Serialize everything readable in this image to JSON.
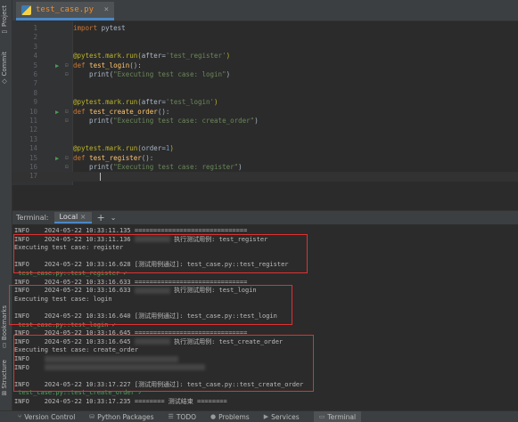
{
  "left_strip": {
    "project_label": "Project",
    "commit_label": "Commit",
    "bookmarks_label": "Bookmarks",
    "structure_label": "Structure"
  },
  "editor": {
    "tab_name": "test_case.py",
    "tab_close": "×",
    "lines": [
      {
        "n": "1",
        "parts": [
          {
            "t": "import ",
            "c": "kw"
          },
          {
            "t": "pytest",
            "c": "plain"
          }
        ]
      },
      {
        "n": "2",
        "parts": []
      },
      {
        "n": "3",
        "parts": []
      },
      {
        "n": "4",
        "parts": [
          {
            "t": "@pytest.mark.run(",
            "c": "dec"
          },
          {
            "t": "after=",
            "c": "plain"
          },
          {
            "t": "'test_register'",
            "c": "str"
          },
          {
            "t": ")",
            "c": "dec"
          }
        ]
      },
      {
        "n": "5",
        "run": true,
        "fold": true,
        "parts": [
          {
            "t": "def ",
            "c": "kw"
          },
          {
            "t": "test_login",
            "c": "fn"
          },
          {
            "t": "():",
            "c": "plain"
          }
        ]
      },
      {
        "n": "6",
        "fold": true,
        "parts": [
          {
            "t": "    print(",
            "c": "plain"
          },
          {
            "t": "\"Executing test case: login\"",
            "c": "str"
          },
          {
            "t": ")",
            "c": "plain"
          }
        ]
      },
      {
        "n": "7",
        "parts": []
      },
      {
        "n": "8",
        "parts": []
      },
      {
        "n": "9",
        "parts": [
          {
            "t": "@pytest.mark.run(",
            "c": "dec"
          },
          {
            "t": "after=",
            "c": "plain"
          },
          {
            "t": "'test_login'",
            "c": "str"
          },
          {
            "t": ")",
            "c": "dec"
          }
        ]
      },
      {
        "n": "10",
        "run": true,
        "fold": true,
        "parts": [
          {
            "t": "def ",
            "c": "kw"
          },
          {
            "t": "test_create_order",
            "c": "fn"
          },
          {
            "t": "():",
            "c": "plain"
          }
        ]
      },
      {
        "n": "11",
        "fold": true,
        "parts": [
          {
            "t": "    print(",
            "c": "plain"
          },
          {
            "t": "\"Executing test case: create_order\"",
            "c": "str"
          },
          {
            "t": ")",
            "c": "plain"
          }
        ]
      },
      {
        "n": "12",
        "parts": []
      },
      {
        "n": "13",
        "parts": []
      },
      {
        "n": "14",
        "parts": [
          {
            "t": "@pytest.mark.run(",
            "c": "dec"
          },
          {
            "t": "order=",
            "c": "plain"
          },
          {
            "t": "1",
            "c": "num"
          },
          {
            "t": ")",
            "c": "dec"
          }
        ]
      },
      {
        "n": "15",
        "run": true,
        "fold": true,
        "parts": [
          {
            "t": "def ",
            "c": "kw"
          },
          {
            "t": "test_register",
            "c": "fn"
          },
          {
            "t": "():",
            "c": "plain"
          }
        ]
      },
      {
        "n": "16",
        "fold": true,
        "parts": [
          {
            "t": "    print(",
            "c": "plain"
          },
          {
            "t": "\"Executing test case: register\"",
            "c": "str"
          },
          {
            "t": ")",
            "c": "plain"
          }
        ]
      },
      {
        "n": "17",
        "current": true,
        "parts": []
      }
    ]
  },
  "terminal": {
    "label": "Terminal:",
    "tab": "Local",
    "tab_close": "×",
    "add": "+",
    "dropdown": "⌄",
    "lines": [
      {
        "t": "INFO    2024-05-22 10:33:11.135 ==============================",
        "c": ""
      },
      {
        "t": "INFO    2024-05-22 10:33:11.136 ",
        "blur": 40,
        "tail": " 执行测试用例: test_register",
        "c": ""
      },
      {
        "t": "Executing test case: register",
        "c": ""
      },
      {
        "t": "",
        "c": ""
      },
      {
        "t": "INFO    2024-05-22 10:33:16.628 [测试用例通过]: test_case.py::test_register",
        "c": ""
      },
      {
        "t": " test_case.py::test_register ✓",
        "c": "green"
      },
      {
        "t": "INFO    2024-05-22 10:33:16.633 ==============================",
        "c": ""
      },
      {
        "t": "INFO    2024-05-22 10:33:16.633 ",
        "blur": 40,
        "tail": " 执行测试用例: test_login",
        "c": ""
      },
      {
        "t": "Executing test case: login",
        "c": ""
      },
      {
        "t": "",
        "c": ""
      },
      {
        "t": "INFO    2024-05-22 10:33:16.640 [测试用例通过]: test_case.py::test_login",
        "c": ""
      },
      {
        "t": " test_case.py::test_login ✓",
        "c": "green"
      },
      {
        "t": "INFO    2024-05-22 10:33:16.645 ==============================",
        "c": ""
      },
      {
        "t": "INFO    2024-05-22 10:33:16.645 ",
        "blur": 40,
        "tail": " 执行测试用例: test_create_order",
        "c": ""
      },
      {
        "t": "Executing test case: create_order",
        "c": ""
      },
      {
        "t": "INFO    ",
        "blur": 150,
        "tail": "",
        "c": ""
      },
      {
        "t": "INFO    ",
        "blur": 180,
        "tail": "",
        "c": ""
      },
      {
        "t": "",
        "c": ""
      },
      {
        "t": "INFO    2024-05-22 10:33:17.227 [测试用例通过]: test_case.py::test_create_order",
        "c": ""
      },
      {
        "t": " test_case.py::test_create_order ✓",
        "c": "green"
      },
      {
        "t": "INFO    2024-05-22 10:33:17.235 ======== 测试结束 ========",
        "c": ""
      }
    ]
  },
  "statusbar": {
    "items": [
      {
        "icon": "⑂",
        "label": "Version Control"
      },
      {
        "icon": "⛁",
        "label": "Python Packages"
      },
      {
        "icon": "☰",
        "label": "TODO"
      },
      {
        "icon": "●",
        "label": "Problems"
      },
      {
        "icon": "▶",
        "label": "Services"
      },
      {
        "icon": "▭",
        "label": "Terminal",
        "active": true
      }
    ]
  }
}
